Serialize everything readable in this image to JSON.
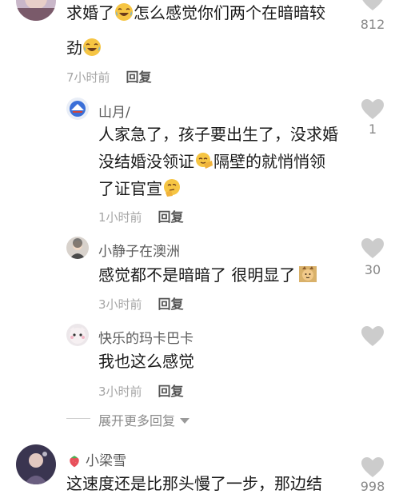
{
  "comments": [
    {
      "text_lines": [
        "求婚了",
        "怎么感觉你们两个在暗暗较",
        "劲"
      ],
      "time": "7小时前",
      "reply": "回复",
      "likes": "812",
      "emoji": "laughing-tears-emoji"
    },
    {
      "name": "山月/",
      "text_lines": [
        "人家急了，孩子要出生了，没求婚",
        "没结婚没领证",
        "隔壁的就悄悄领",
        "了证官宣"
      ],
      "time": "1小时前",
      "reply": "回复",
      "likes": "1",
      "emoji": [
        "sly-hand-emoji",
        "thinking-emoji"
      ]
    },
    {
      "name": "小静子在澳洲",
      "text_lines": [
        "感觉都不是暗暗了 很明显了"
      ],
      "time": "3小时前",
      "reply": "回复",
      "likes": "30",
      "emoji": "cat-sticker"
    },
    {
      "name": "快乐的玛卡巴卡",
      "text_lines": [
        "我也这么感觉"
      ],
      "time": "3小时前",
      "reply": "回复",
      "likes": ""
    },
    {
      "name": "小梁雪",
      "text_lines": [
        "这速度还是比那头慢了一步，那边结"
      ],
      "likes": "998",
      "badge_icon": "strawberry-icon"
    }
  ],
  "expand": {
    "label": "展开更多回复"
  },
  "colors": {
    "heart": "#cccccc",
    "meta": "#a6a6a6",
    "name": "#5a5a5a"
  }
}
